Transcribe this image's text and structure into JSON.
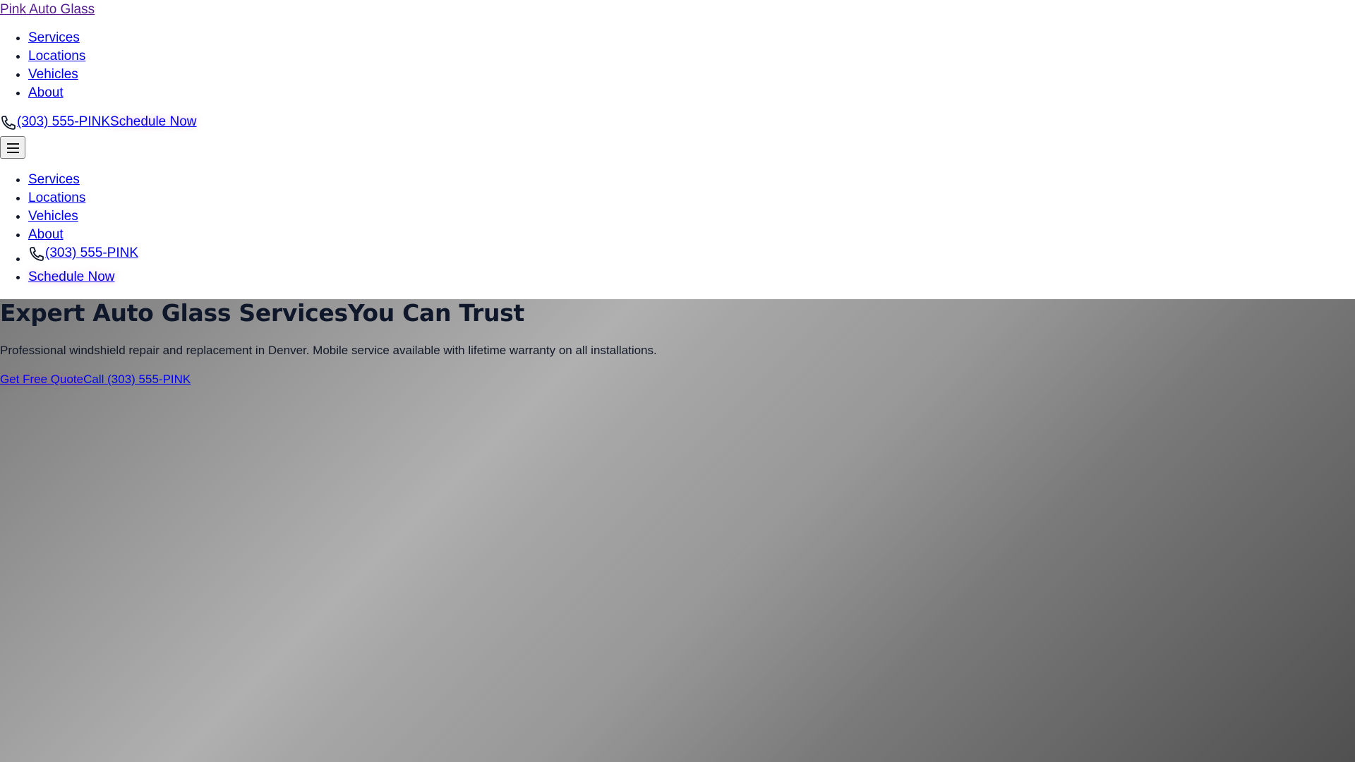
{
  "brand": {
    "logo_text": "Pink Auto Glass",
    "accent_color": "#ec4899"
  },
  "nav": {
    "primary_items": [
      {
        "label": "Services"
      },
      {
        "label": "Locations"
      },
      {
        "label": "Vehicles"
      },
      {
        "label": "About"
      }
    ],
    "phone_label": "(303) 555-PINK",
    "schedule_label": "Schedule Now",
    "menu_icon": "hamburger-menu-icon",
    "phone_icon": "phone-icon"
  },
  "mobile_nav": {
    "items": [
      {
        "label": "Services"
      },
      {
        "label": "Locations"
      },
      {
        "label": "Vehicles"
      },
      {
        "label": "About"
      }
    ],
    "phone_label": "(303) 555-PINK",
    "schedule_label": "Schedule Now"
  },
  "hero": {
    "title_part1": "Expert Auto Glass Services",
    "title_part2": "You Can Trust",
    "subtitle": "Professional windshield repair and replacement in Denver. Mobile service available with lifetime warranty on all installations.",
    "cta_quote": "Get Free Quote",
    "cta_call": "Call (303) 555-PINK"
  }
}
